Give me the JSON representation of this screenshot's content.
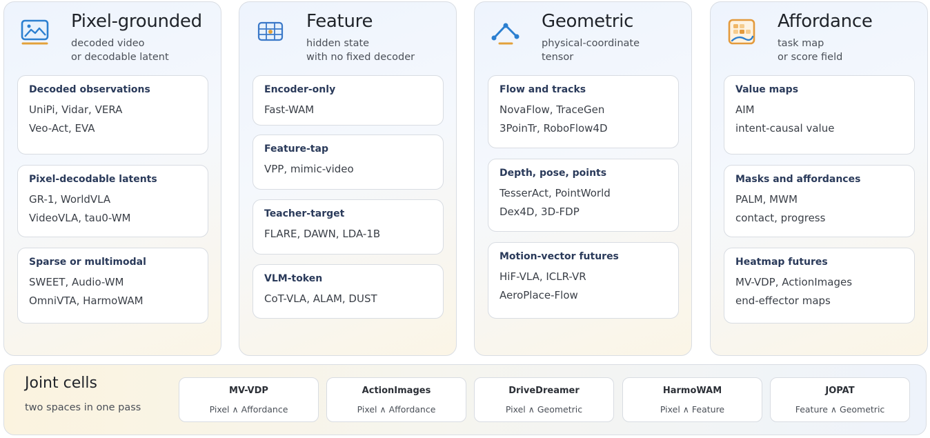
{
  "columns": [
    {
      "title": "Pixel-grounded",
      "subtitle": [
        "decoded video",
        "or decodable latent"
      ],
      "icon": "image-frame-icon",
      "cards": [
        {
          "title": "Decoded observations",
          "lines": [
            "UniPi, Vidar, VERA",
            "Veo-Act, EVA"
          ]
        },
        {
          "title": "Pixel-decodable latents",
          "lines": [
            "GR-1, WorldVLA",
            "VideoVLA, tau0-WM"
          ]
        },
        {
          "title": "Sparse or multimodal",
          "lines": [
            "SWEET, Audio-WM",
            "OmniVTA, HarmoWAM"
          ]
        }
      ]
    },
    {
      "title": "Feature",
      "subtitle": [
        "hidden state",
        "with no fixed decoder"
      ],
      "icon": "feature-grid-icon",
      "cards": [
        {
          "title": "Encoder-only",
          "lines": [
            "Fast-WAM"
          ]
        },
        {
          "title": "Feature-tap",
          "lines": [
            "VPP, mimic-video"
          ]
        },
        {
          "title": "Teacher-target",
          "lines": [
            "FLARE, DAWN, LDA-1B"
          ]
        },
        {
          "title": "VLM-token",
          "lines": [
            "CoT-VLA, ALAM, DUST"
          ]
        }
      ]
    },
    {
      "title": "Geometric",
      "subtitle": [
        "physical-coordinate",
        "tensor"
      ],
      "icon": "geometry-nodes-icon",
      "cards": [
        {
          "title": "Flow and tracks",
          "lines": [
            "NovaFlow, TraceGen",
            "3PoinTr, RoboFlow4D"
          ]
        },
        {
          "title": "Depth, pose, points",
          "lines": [
            "TesserAct, PointWorld",
            "Dex4D, 3D-FDP"
          ]
        },
        {
          "title": "Motion-vector futures",
          "lines": [
            "HiF-VLA, ICLR-VR",
            "AeroPlace-Flow"
          ]
        }
      ]
    },
    {
      "title": "Affordance",
      "subtitle": [
        "task map",
        "or score field"
      ],
      "icon": "affordance-map-icon",
      "cards": [
        {
          "title": "Value maps",
          "lines": [
            "AIM",
            "intent-causal value"
          ]
        },
        {
          "title": "Masks and affordances",
          "lines": [
            "PALM, MWM",
            "contact, progress"
          ]
        },
        {
          "title": "Heatmap futures",
          "lines": [
            "MV-VDP, ActionImages",
            "end-effector maps"
          ]
        }
      ]
    }
  ],
  "joint": {
    "title": "Joint cells",
    "subtitle": "two spaces in one pass",
    "pairs": [
      {
        "name": "MV-VDP",
        "desc": "Pixel ∧ Affordance"
      },
      {
        "name": "ActionImages",
        "desc": "Pixel ∧ Affordance"
      },
      {
        "name": "DriveDreamer",
        "desc": "Pixel ∧ Geometric"
      },
      {
        "name": "HarmoWAM",
        "desc": "Pixel ∧ Feature"
      },
      {
        "name": "JOPAT",
        "desc": "Feature ∧ Geometric"
      }
    ]
  },
  "colors": {
    "pixel_icon": "#2b7fd0",
    "feature_icon": "#3a78c8",
    "geometric_icon": "#2b7fd0",
    "affordance_icon": "#e39a3c",
    "accent_orange": "#e3a13a"
  }
}
